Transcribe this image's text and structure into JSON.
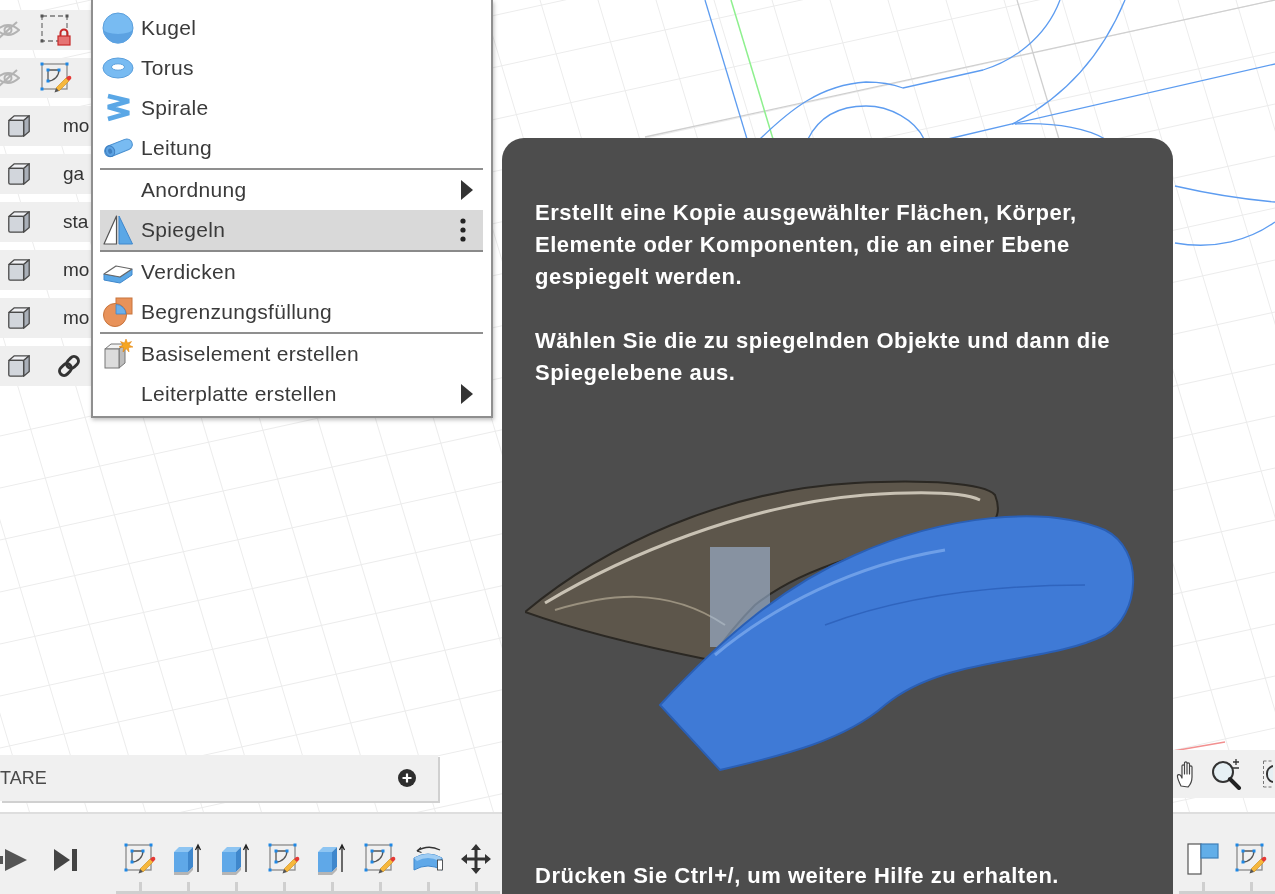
{
  "browser": {
    "sketches": [
      {
        "visible": false,
        "locked": true
      },
      {
        "visible": false,
        "locked": false
      }
    ],
    "bodies": [
      {
        "label": "mo",
        "linked": false
      },
      {
        "label": "ga",
        "linked": false
      },
      {
        "label": "sta",
        "linked": false
      },
      {
        "label": "mo",
        "linked": false
      },
      {
        "label": "mo",
        "linked": false
      },
      {
        "linked": true
      }
    ]
  },
  "menu": {
    "groups": [
      [
        {
          "label": "Kugel",
          "kind": "command",
          "selected": false
        },
        {
          "label": "Torus",
          "kind": "command",
          "selected": false
        },
        {
          "label": "Spirale",
          "kind": "command",
          "selected": false
        },
        {
          "label": "Leitung",
          "kind": "command",
          "selected": false
        }
      ],
      [
        {
          "label": "Anordnung",
          "kind": "submenu",
          "selected": false
        },
        {
          "label": "Spiegeln",
          "kind": "command",
          "selected": true
        },
        {
          "label": "Verdicken",
          "kind": "command",
          "selected": false
        },
        {
          "label": "Begrenzungsfüllung",
          "kind": "command",
          "selected": false
        }
      ],
      [
        {
          "label": "Basiselement erstellen",
          "kind": "command",
          "selected": false
        },
        {
          "label": "Leiterplatte erstellen",
          "kind": "submenu",
          "selected": false
        }
      ]
    ]
  },
  "tooltip": {
    "paragraphs": [
      "Erstellt eine Kopie ausgewählter Flächen, Körper, Elemente oder Komponenten, die an einer Ebene gespiegelt werden.",
      "Wählen Sie die zu spiegelnden Objekte und dann die Spiegelebene aus."
    ],
    "footer": "Drücken Sie Ctrl+/, um weitere Hilfe zu erhalten."
  },
  "comments": {
    "title": "TARE"
  },
  "timeline": {
    "features": [
      {
        "kind": "sketch"
      },
      {
        "kind": "extrude"
      },
      {
        "kind": "extrude"
      },
      {
        "kind": "sketch"
      },
      {
        "kind": "extrude"
      },
      {
        "kind": "sketch"
      },
      {
        "kind": "sweep"
      },
      {
        "kind": "move"
      }
    ],
    "trailing_features": [
      {
        "kind": "split"
      },
      {
        "kind": "sketch"
      }
    ]
  }
}
